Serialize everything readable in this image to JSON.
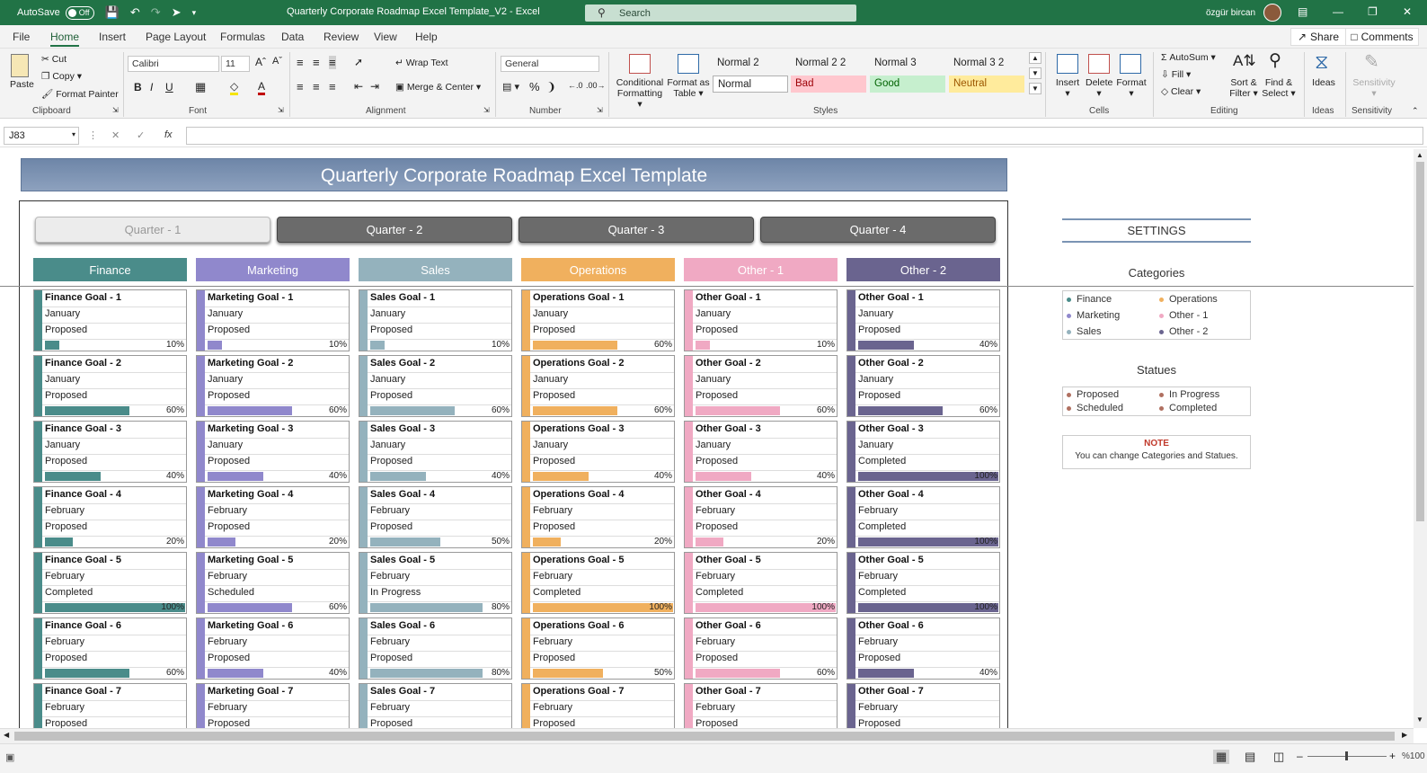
{
  "titlebar": {
    "autosave_label": "AutoSave",
    "autosave_state": "Off",
    "doc_title": "Quarterly Corporate Roadmap Excel Template_V2  -  Excel",
    "search_placeholder": "Search",
    "user_name": "özgür bircan"
  },
  "tabs": [
    "File",
    "Home",
    "Insert",
    "Page Layout",
    "Formulas",
    "Data",
    "Review",
    "View",
    "Help"
  ],
  "share_label": "Share",
  "comments_label": "Comments",
  "ribbon": {
    "clipboard": {
      "paste": "Paste",
      "cut": "Cut",
      "copy": "Copy",
      "format_painter": "Format Painter",
      "group": "Clipboard"
    },
    "font": {
      "name": "Calibri",
      "size": "11",
      "group": "Font"
    },
    "alignment": {
      "wrap": "Wrap Text",
      "merge": "Merge & Center",
      "group": "Alignment"
    },
    "number": {
      "format": "General",
      "group": "Number"
    },
    "styles": {
      "conditional": "Conditional",
      "conditional2": "Formatting",
      "format_as": "Format as",
      "format_as2": "Table",
      "group": "Styles",
      "row1": [
        "Normal 2",
        "Normal 2 2",
        "Normal 3",
        "Normal 3 2"
      ],
      "row2": [
        "Normal",
        "Bad",
        "Good",
        "Neutral"
      ]
    },
    "cells": {
      "insert": "Insert",
      "delete": "Delete",
      "format": "Format",
      "group": "Cells"
    },
    "editing": {
      "autosum": "AutoSum",
      "fill": "Fill",
      "clear": "Clear",
      "sort": "Sort &",
      "sort2": "Filter",
      "find": "Find &",
      "find2": "Select",
      "group": "Editing"
    },
    "ideas": {
      "label": "Ideas",
      "group": "Ideas"
    },
    "sensitivity": {
      "label": "Sensitivity",
      "group": "Sensitivity"
    }
  },
  "formula_bar": {
    "cell_ref": "J83",
    "fx": "fx",
    "content": ""
  },
  "sheet": {
    "banner": "Quarterly Corporate Roadmap Excel Template",
    "quarters": [
      "Quarter - 1",
      "Quarter - 2",
      "Quarter - 3",
      "Quarter - 4"
    ],
    "active_quarter_index": 0,
    "categories": [
      {
        "name": "Finance",
        "color": "#4a8c8a",
        "prefix": "Finance Goal - "
      },
      {
        "name": "Marketing",
        "color": "#9088cc",
        "prefix": "Marketing Goal - "
      },
      {
        "name": "Sales",
        "color": "#94b2bd",
        "prefix": "Sales Goal - "
      },
      {
        "name": "Operations",
        "color": "#f0b05e",
        "prefix": "Operations Goal - "
      },
      {
        "name": "Other - 1",
        "color": "#f0a9c3",
        "prefix": "Other Goal - "
      },
      {
        "name": "Other - 2",
        "color": "#6a648f",
        "prefix": "Other Goal - "
      }
    ],
    "goals": [
      [
        {
          "n": "1",
          "month": "January",
          "status": "Proposed",
          "pct": 10
        },
        {
          "n": "2",
          "month": "January",
          "status": "Proposed",
          "pct": 60
        },
        {
          "n": "3",
          "month": "January",
          "status": "Proposed",
          "pct": 40
        },
        {
          "n": "4",
          "month": "February",
          "status": "Proposed",
          "pct": 20
        },
        {
          "n": "5",
          "month": "February",
          "status": "Completed",
          "pct": 100
        },
        {
          "n": "6",
          "month": "February",
          "status": "Proposed",
          "pct": 60
        },
        {
          "n": "7",
          "month": "February",
          "status": "Proposed",
          "pct": null
        }
      ],
      [
        {
          "n": "1",
          "month": "January",
          "status": "Proposed",
          "pct": 10
        },
        {
          "n": "2",
          "month": "January",
          "status": "Proposed",
          "pct": 60
        },
        {
          "n": "3",
          "month": "January",
          "status": "Proposed",
          "pct": 40
        },
        {
          "n": "4",
          "month": "February",
          "status": "Proposed",
          "pct": 20
        },
        {
          "n": "5",
          "month": "February",
          "status": "Scheduled",
          "pct": 60
        },
        {
          "n": "6",
          "month": "February",
          "status": "Proposed",
          "pct": 40
        },
        {
          "n": "7",
          "month": "February",
          "status": "Proposed",
          "pct": null
        }
      ],
      [
        {
          "n": "1",
          "month": "January",
          "status": "Proposed",
          "pct": 10
        },
        {
          "n": "2",
          "month": "January",
          "status": "Proposed",
          "pct": 60
        },
        {
          "n": "3",
          "month": "January",
          "status": "Proposed",
          "pct": 40
        },
        {
          "n": "4",
          "month": "February",
          "status": "Proposed",
          "pct": 50
        },
        {
          "n": "5",
          "month": "February",
          "status": "In Progress",
          "pct": 80
        },
        {
          "n": "6",
          "month": "February",
          "status": "Proposed",
          "pct": 80
        },
        {
          "n": "7",
          "month": "February",
          "status": "Proposed",
          "pct": null
        }
      ],
      [
        {
          "n": "1",
          "month": "January",
          "status": "Proposed",
          "pct": 60
        },
        {
          "n": "2",
          "month": "January",
          "status": "Proposed",
          "pct": 60
        },
        {
          "n": "3",
          "month": "January",
          "status": "Proposed",
          "pct": 40
        },
        {
          "n": "4",
          "month": "February",
          "status": "Proposed",
          "pct": 20
        },
        {
          "n": "5",
          "month": "February",
          "status": "Completed",
          "pct": 100
        },
        {
          "n": "6",
          "month": "February",
          "status": "Proposed",
          "pct": 50
        },
        {
          "n": "7",
          "month": "February",
          "status": "Proposed",
          "pct": null
        }
      ],
      [
        {
          "n": "1",
          "month": "January",
          "status": "Proposed",
          "pct": 10
        },
        {
          "n": "2",
          "month": "January",
          "status": "Proposed",
          "pct": 60
        },
        {
          "n": "3",
          "month": "January",
          "status": "Proposed",
          "pct": 40
        },
        {
          "n": "4",
          "month": "February",
          "status": "Proposed",
          "pct": 20
        },
        {
          "n": "5",
          "month": "February",
          "status": "Completed",
          "pct": 100
        },
        {
          "n": "6",
          "month": "February",
          "status": "Proposed",
          "pct": 60
        },
        {
          "n": "7",
          "month": "February",
          "status": "Proposed",
          "pct": null
        }
      ],
      [
        {
          "n": "1",
          "month": "January",
          "status": "Proposed",
          "pct": 40
        },
        {
          "n": "2",
          "month": "January",
          "status": "Proposed",
          "pct": 60
        },
        {
          "n": "3",
          "month": "January",
          "status": "Completed",
          "pct": 100
        },
        {
          "n": "4",
          "month": "February",
          "status": "Completed",
          "pct": 100
        },
        {
          "n": "5",
          "month": "February",
          "status": "Completed",
          "pct": 100
        },
        {
          "n": "6",
          "month": "February",
          "status": "Proposed",
          "pct": 40
        },
        {
          "n": "7",
          "month": "February",
          "status": "Proposed",
          "pct": null
        }
      ]
    ],
    "settings": {
      "title": "SETTINGS",
      "categories_label": "Categories",
      "categories": [
        "Finance",
        "Operations",
        "Marketing",
        "Other - 1",
        "Sales",
        "Other - 2"
      ],
      "statues_label": "Statues",
      "statues": [
        "Proposed",
        "In Progress",
        "Scheduled",
        "Completed"
      ],
      "note_title": "NOTE",
      "note_text": "You can change Categories and Statues."
    }
  },
  "statusbar": {
    "zoom": "%100"
  }
}
